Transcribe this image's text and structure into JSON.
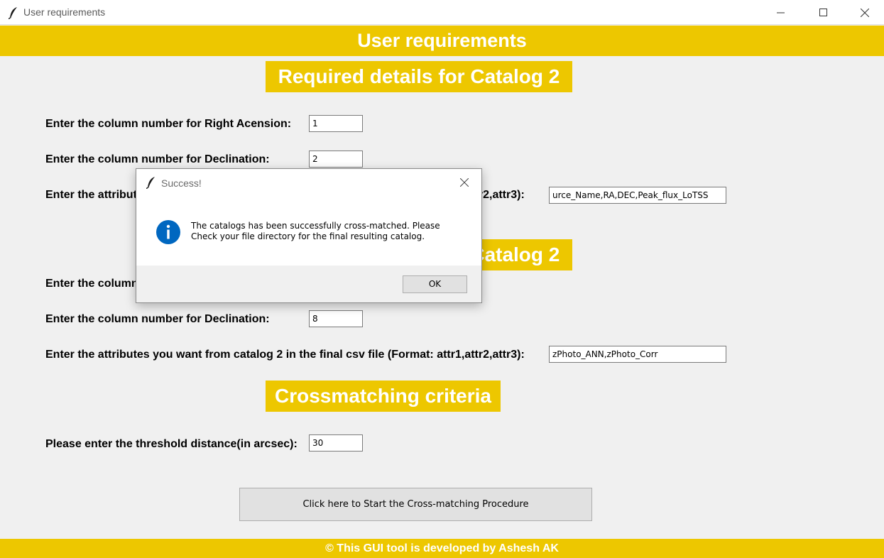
{
  "window": {
    "title": "User requirements",
    "icon": "feather-icon",
    "controls": [
      "minimize-icon",
      "maximize-icon",
      "close-icon"
    ]
  },
  "header": {
    "title": "User requirements"
  },
  "catalog_section": {
    "title": "Required details for Catalog 2",
    "ra_label": "Enter the column number for Right Acension:",
    "ra_value": "1",
    "dec_label": "Enter the column number for Declination:",
    "dec_value": "2",
    "attr_label": "Enter the attributes you want from catalog 2 in the final csv file (Format: attr1,attr2,attr3):",
    "attr_value": "urce_Name,RA,DEC,Peak_flux_LoTSS"
  },
  "catalog2_section": {
    "title": "Required details for Catalog 2",
    "ra_label": "Enter the column number for Right Acension:",
    "dec_label": "Enter the column number for Declination:",
    "dec_value": "8",
    "attr_label": "Enter the attributes you want from catalog 2 in the final csv file (Format: attr1,attr2,attr3):",
    "attr_value": "zPhoto_ANN,zPhoto_Corr"
  },
  "criteria_section": {
    "title": "Crossmatching criteria",
    "threshold_label": "Please enter the threshold distance(in arcsec):",
    "threshold_value": "30"
  },
  "start_button": {
    "label": "Click here to Start the Cross-matching Procedure"
  },
  "footer": {
    "text": "© This GUI tool is developed by Ashesh AK"
  },
  "dialog": {
    "title": "Success!",
    "icon": "info-icon",
    "message_line1": "The catalogs has been successfully cross-matched. Please",
    "message_line2": "Check your file directory for the final resulting catalog.",
    "ok_label": "OK"
  },
  "colors": {
    "accent": "#edc700",
    "background": "#f0f0f0",
    "info_blue": "#0067c0"
  }
}
